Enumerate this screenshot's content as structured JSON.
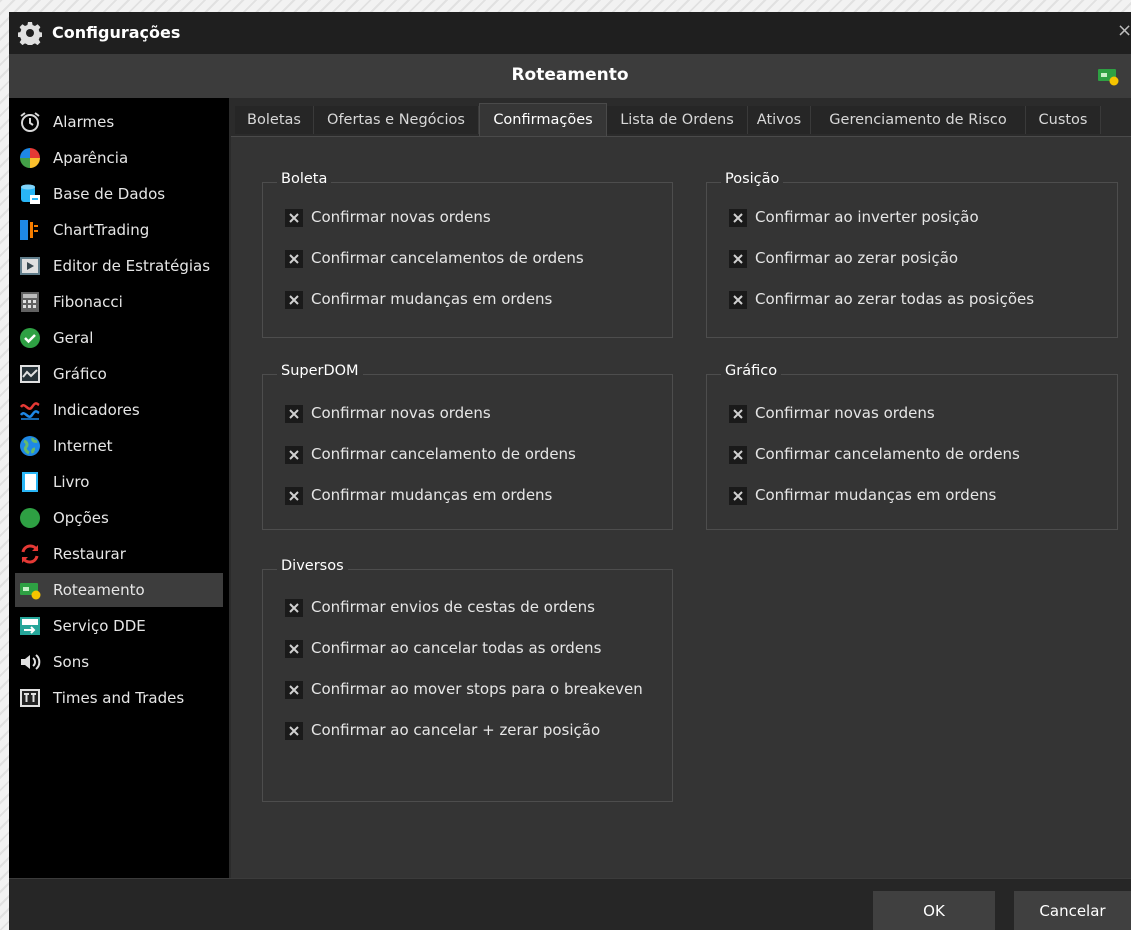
{
  "window": {
    "title": "Configurações",
    "close_glyph": "×"
  },
  "header": {
    "title": "Roteamento",
    "icon": "routing-icon"
  },
  "sidebar": {
    "items": [
      {
        "label": "Alarmes",
        "icon": "alarm-clock-icon"
      },
      {
        "label": "Aparência",
        "icon": "color-wheel-icon"
      },
      {
        "label": "Base de Dados",
        "icon": "database-icon"
      },
      {
        "label": "ChartTrading",
        "icon": "chart-trading-icon"
      },
      {
        "label": "Editor de Estratégias",
        "icon": "play-editor-icon"
      },
      {
        "label": "Fibonacci",
        "icon": "calculator-icon"
      },
      {
        "label": "Geral",
        "icon": "checkmark-circle-icon"
      },
      {
        "label": "Gráfico",
        "icon": "line-chart-icon"
      },
      {
        "label": "Indicadores",
        "icon": "indicators-icon"
      },
      {
        "label": "Internet",
        "icon": "globe-icon"
      },
      {
        "label": "Livro",
        "icon": "book-icon"
      },
      {
        "label": "Opções",
        "icon": "options-circle-icon"
      },
      {
        "label": "Restaurar",
        "icon": "restore-arrows-icon"
      },
      {
        "label": "Roteamento",
        "icon": "routing-icon",
        "active": true
      },
      {
        "label": "Serviço DDE",
        "icon": "dde-service-icon"
      },
      {
        "label": "Sons",
        "icon": "speaker-icon"
      },
      {
        "label": "Times and Trades",
        "icon": "times-trades-icon"
      }
    ]
  },
  "tabs": [
    {
      "label": "Boletas"
    },
    {
      "label": "Ofertas e Negócios"
    },
    {
      "label": "Confirmações",
      "active": true
    },
    {
      "label": "Lista de Ordens"
    },
    {
      "label": "Ativos"
    },
    {
      "label": "Gerenciamento de Risco"
    },
    {
      "label": "Custos"
    }
  ],
  "groups": {
    "boleta": {
      "title": "Boleta",
      "options": [
        "Confirmar novas ordens",
        "Confirmar cancelamentos de ordens",
        "Confirmar mudanças em ordens"
      ]
    },
    "posicao": {
      "title": "Posição",
      "options": [
        "Confirmar ao inverter posição",
        "Confirmar ao zerar posição",
        "Confirmar ao zerar todas as posições"
      ]
    },
    "superdom": {
      "title": "SuperDOM",
      "options": [
        "Confirmar novas ordens",
        "Confirmar cancelamento de ordens",
        "Confirmar mudanças em ordens"
      ]
    },
    "grafico": {
      "title": "Gráfico",
      "options": [
        "Confirmar novas ordens",
        "Confirmar cancelamento de ordens",
        "Confirmar mudanças em ordens"
      ]
    },
    "diversos": {
      "title": "Diversos",
      "options": [
        "Confirmar envios de cestas de ordens",
        "Confirmar ao cancelar todas as ordens",
        "Confirmar ao mover stops para o breakeven",
        "Confirmar ao cancelar + zerar posição"
      ]
    }
  },
  "footer": {
    "ok_label": "OK",
    "cancel_label": "Cancelar"
  },
  "colors": {
    "window_bg": "#2b2b2b",
    "sidebar_bg": "#000000",
    "content_bg": "#343434",
    "accent_green": "#2ea043"
  }
}
